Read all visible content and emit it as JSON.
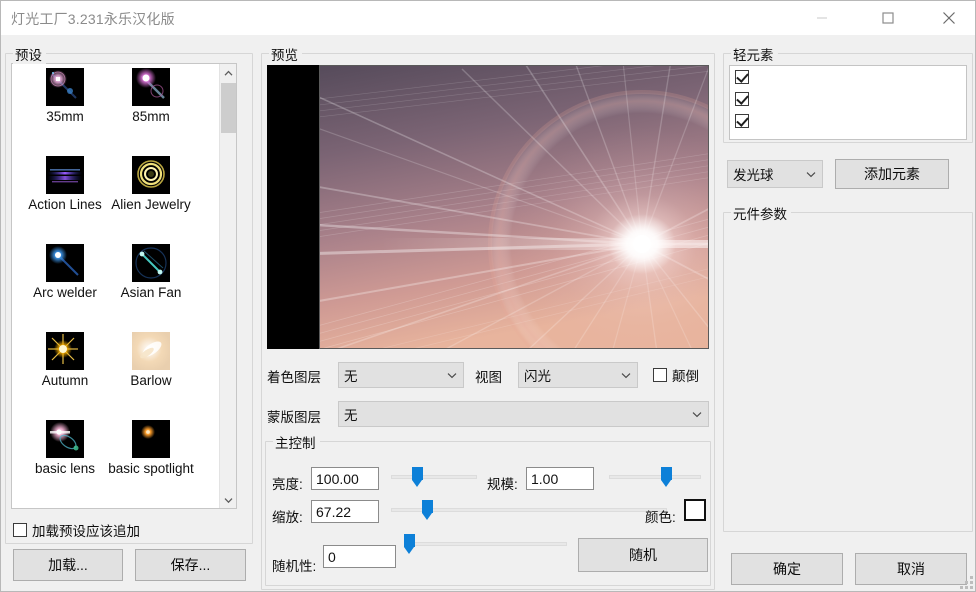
{
  "window": {
    "title": "灯光工厂3.231永乐汉化版",
    "minimize_icon": "minimize-icon",
    "maximize_icon": "maximize-icon",
    "close_icon": "close-icon"
  },
  "presets_panel": {
    "group_label": "预设",
    "items": [
      {
        "name": "35mm",
        "thumb": "flare-35mm"
      },
      {
        "name": "85mm",
        "thumb": "flare-85mm"
      },
      {
        "name": "Action Lines",
        "thumb": "flare-action-lines"
      },
      {
        "name": "Alien Jewelry",
        "thumb": "flare-alien-jewelry"
      },
      {
        "name": "Arc welder",
        "thumb": "flare-arc-welder"
      },
      {
        "name": "Asian Fan",
        "thumb": "flare-asian-fan"
      },
      {
        "name": "Autumn",
        "thumb": "flare-autumn"
      },
      {
        "name": "Barlow",
        "thumb": "flare-barlow"
      },
      {
        "name": "basic lens",
        "thumb": "flare-basic-lens"
      },
      {
        "name": "basic spotlight",
        "thumb": "flare-basic-spotlight"
      }
    ],
    "append_checkbox": {
      "label": "加载预设应该追加",
      "checked": false
    },
    "load_button": "加载...",
    "save_button": "保存...",
    "scrollbar": {
      "up_icon": "chevron-up-icon",
      "down_icon": "chevron-down-icon"
    }
  },
  "preview_panel": {
    "group_label": "预览",
    "tint_layer": {
      "label": "着色图层",
      "value": "无"
    },
    "view": {
      "label": "视图",
      "value": "闪光"
    },
    "invert": {
      "label": "颠倒",
      "checked": false
    },
    "mask_layer": {
      "label": "蒙版图层",
      "value": "无"
    },
    "main_controls": {
      "group_label": "主控制",
      "brightness": {
        "label": "亮度:",
        "value": "100.00",
        "slider_pct": 30
      },
      "scale": {
        "label": "规模:",
        "value": "1.00",
        "slider_pct": 62
      },
      "zoom": {
        "label": "缩放:",
        "value": "67.22",
        "slider_pct": 13
      },
      "color": {
        "label": "颜色:",
        "value": "#ffffff"
      },
      "randomness": {
        "label": "随机性:",
        "value": "0",
        "slider_pct": 0
      },
      "random_button": "随机"
    }
  },
  "elements_panel": {
    "light_elements": {
      "group_label": "轻元素",
      "rows": [
        {
          "label": "",
          "checked": true
        },
        {
          "label": "",
          "checked": true
        },
        {
          "label": "",
          "checked": true
        }
      ]
    },
    "element_type": {
      "value": "发光球"
    },
    "add_element_button": "添加元素",
    "params": {
      "group_label": "元件参数"
    },
    "ok_button": "确定",
    "cancel_button": "取消"
  },
  "colors": {
    "accent": "#0d80d8",
    "panel_bg": "#f0f0f0",
    "field_bg": "#ffffff",
    "button_bg": "#e1e1e1"
  }
}
